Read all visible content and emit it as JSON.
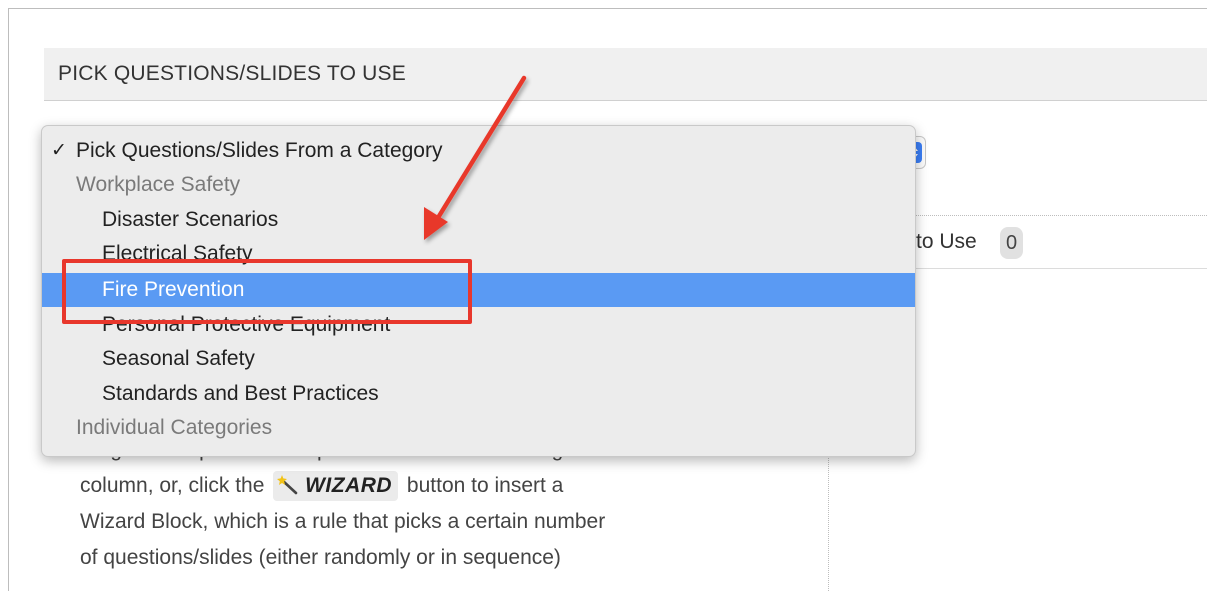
{
  "section": {
    "title": "PICK QUESTIONS/SLIDES TO USE"
  },
  "dropdown": {
    "selected_label": "Pick Questions/Slides From a Category",
    "check_mark": "✓",
    "options": [
      {
        "label": "Workplace Safety",
        "kind": "group"
      },
      {
        "label": "Disaster Scenarios",
        "kind": "option"
      },
      {
        "label": "Electrical Safety",
        "kind": "option"
      },
      {
        "label": "Fire Prevention",
        "kind": "option",
        "highlighted": true
      },
      {
        "label": "Personal Protective Equipment",
        "kind": "option"
      },
      {
        "label": "Seasonal Safety",
        "kind": "option"
      },
      {
        "label": "Standards and Best Practices",
        "kind": "option"
      },
      {
        "label": "Individual Categories",
        "kind": "group"
      }
    ]
  },
  "questions_to_use": {
    "label": "to Use",
    "count": "0"
  },
  "help": {
    "line1": "drag and drop individual questions/slides into the right",
    "line2_before": "column, or, click the",
    "wizard_button": "WIZARD",
    "line2_after": "button to insert a",
    "line3": "Wizard Block, which is a rule that picks a certain number",
    "line4": "of questions/slides (either randomly or in sequence)"
  },
  "colors": {
    "highlight": "#5a9af3",
    "annotation": "#e8372c",
    "select_button": "#3b7ef5"
  },
  "icons": {
    "select": "select-updown-icon",
    "wizard": "magic-wand-icon",
    "check": "checkmark-icon"
  }
}
